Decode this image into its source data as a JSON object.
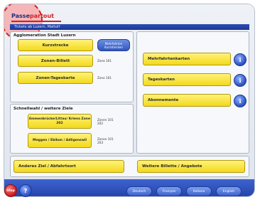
{
  "brand": {
    "name_part1": "Passe",
    "name_part2": "partout"
  },
  "context_bar": "Tickets ab Luzern, Mattolf",
  "left_panel": {
    "title": "Agglomeration Stadt Luzern",
    "buttons": [
      {
        "label": "Kurzstrecke",
        "note": ""
      },
      {
        "label": "Zonen-Billett",
        "note": "Zone 101"
      },
      {
        "label": "Zonen-Tageskarte",
        "note": "Zone 101"
      }
    ],
    "blue_button": "Mehrfahrten Kurzstrecken"
  },
  "schnellwahl": {
    "title": "Schnellwahl / weitere Ziele",
    "buttons": [
      {
        "label": "Emmenbrücke/Littau/ Kriens Zone 202",
        "note": "Zonen 101 202"
      },
      {
        "label": "Meggen / Ebikon / Adligenswil",
        "note": "Zonen 101 203"
      }
    ]
  },
  "right_panel": {
    "buttons": [
      {
        "label": "Mehrfahrtenkarten"
      },
      {
        "label": "Tageskarten"
      },
      {
        "label": "Abonnemente"
      }
    ],
    "info_glyph": "i"
  },
  "bottom_buttons": {
    "other_destination": "Anderes Ziel / Abfahrtsort",
    "more_tickets": "Weitere Billette / Angebote"
  },
  "footer": {
    "stop_label": "Stop",
    "help_glyph": "?",
    "languages": [
      "Deutsch",
      "Français",
      "Italiano",
      "English"
    ]
  }
}
